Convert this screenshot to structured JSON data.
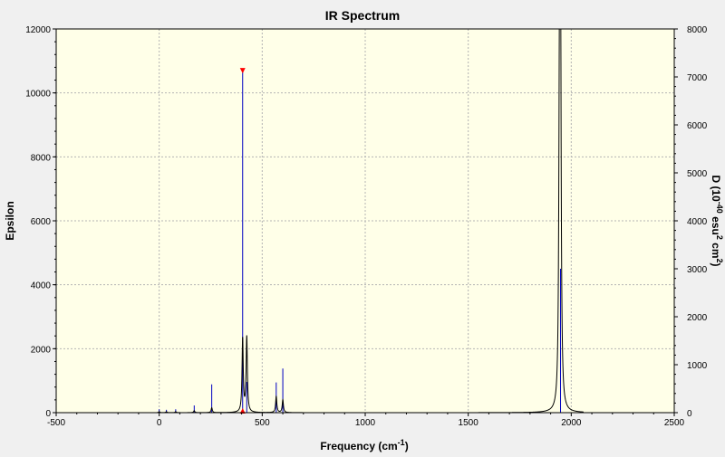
{
  "chart_data": {
    "type": "line",
    "title": "IR Spectrum",
    "xlabel": "Frequency (cm",
    "xlabel_sup": "-1",
    "xlabel_end": ")",
    "ylabel_left": "Epsilon",
    "ylabel_right": {
      "prefix": "D (10",
      "sup1": "-40",
      "mid": " esu",
      "sup2": "2",
      "mid2": " cm",
      "sup3": "2",
      "end": ")"
    },
    "xlim": [
      -500,
      2500
    ],
    "ylim_left": [
      0,
      12000
    ],
    "ylim_right": [
      0,
      8000
    ],
    "x_ticks": [
      -500,
      0,
      500,
      1000,
      1500,
      2000,
      2500
    ],
    "y_left_ticks": [
      0,
      2000,
      4000,
      6000,
      8000,
      10000,
      12000
    ],
    "y_right_ticks": [
      0,
      1000,
      2000,
      3000,
      4000,
      5000,
      6000,
      7000,
      8000
    ],
    "grid": true,
    "colors": {
      "spectrum": "#000000",
      "sticks": "#0000c0",
      "marker": "#ff0000",
      "plot_bg": "#ffffe8",
      "grid": "#b4b4b4"
    },
    "peaks": [
      {
        "x": 0,
        "epsilon": 30,
        "stick": 70
      },
      {
        "x": 35,
        "epsilon": 30,
        "stick": 60
      },
      {
        "x": 80,
        "epsilon": 30,
        "stick": 70
      },
      {
        "x": 170,
        "epsilon": 60,
        "stick": 150
      },
      {
        "x": 255,
        "epsilon": 150,
        "stick": 590
      },
      {
        "x": 405,
        "epsilon": 2300,
        "stick": 7110
      },
      {
        "x": 425,
        "epsilon": 2350,
        "stick": 640
      },
      {
        "x": 568,
        "epsilon": 500,
        "stick": 630
      },
      {
        "x": 600,
        "epsilon": 400,
        "stick": 920
      },
      {
        "x": 1948,
        "epsilon": 9950,
        "stick": 3000
      },
      {
        "x": 1945,
        "epsilon": 8100,
        "stick": 0
      },
      {
        "x": 1942,
        "epsilon": 4800,
        "stick": 0
      }
    ],
    "marker_x": 405
  }
}
